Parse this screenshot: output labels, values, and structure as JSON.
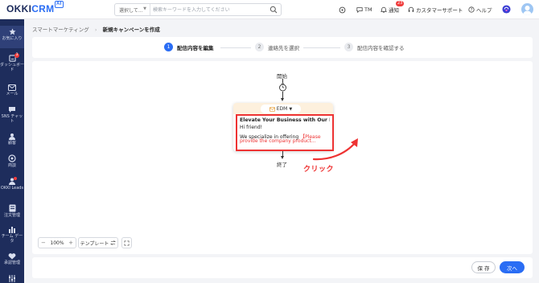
{
  "app": {
    "logo_main": "OKKI",
    "logo_crm": "CRM",
    "logo_ai": "AI"
  },
  "topbar": {
    "search_select": "選択して...",
    "search_placeholder": "検索キーワードを入力してください",
    "tm_label": "TM",
    "notify_label": "通知",
    "notify_count": "23",
    "support_label": "カスタマーサポート",
    "help_label": "ヘルプ"
  },
  "sidebar": {
    "items": [
      {
        "label": "お気に入り",
        "icon": "star-icon"
      },
      {
        "label": "ダッシュボード",
        "icon": "dashboard-icon",
        "badge": "3"
      },
      {
        "label": "メール",
        "icon": "mail-icon"
      },
      {
        "label": "SNS チャット",
        "icon": "chat-icon"
      },
      {
        "label": "顧客",
        "icon": "customers-icon"
      },
      {
        "label": "商談",
        "icon": "deal-icon"
      },
      {
        "label": "OKKI Leads",
        "icon": "leads-icon"
      },
      {
        "label": "注文管理",
        "icon": "order-icon"
      },
      {
        "label": "チーム データ",
        "icon": "team-data-icon"
      },
      {
        "label": "承認管理",
        "icon": "approval-icon"
      }
    ]
  },
  "breadcrumb": {
    "parent": "スマートマーケティング",
    "current": "新規キャンペーンを作成"
  },
  "steps": [
    {
      "num": "1",
      "label": "配信内容を編集",
      "active": true
    },
    {
      "num": "2",
      "label": "連絡先を選択",
      "active": false
    },
    {
      "num": "3",
      "label": "配信内容を確認する",
      "active": false
    }
  ],
  "flow": {
    "start_label": "開始",
    "end_label": "終了",
    "node_type": "EDM",
    "email_title": "Elevate Your Business with Our Pr...",
    "email_greeting": "Hi friend!",
    "email_body_prefix": "We specialize in offering ",
    "email_body_placeholder_1": "【Please",
    "email_body_placeholder_2": "provide the company product..."
  },
  "annotation": {
    "click_label": "クリック",
    "color": "#e33333"
  },
  "canvas_tools": {
    "zoom_minus": "−",
    "zoom_value": "100%",
    "zoom_plus": "+",
    "template_label": "テンプレート"
  },
  "footer": {
    "save_label": "保 存",
    "next_label": "次へ"
  },
  "colors": {
    "accent": "#2a6df4",
    "sidebar_bg": "#1e2d5c",
    "edm_header": "#fdf0dd"
  }
}
